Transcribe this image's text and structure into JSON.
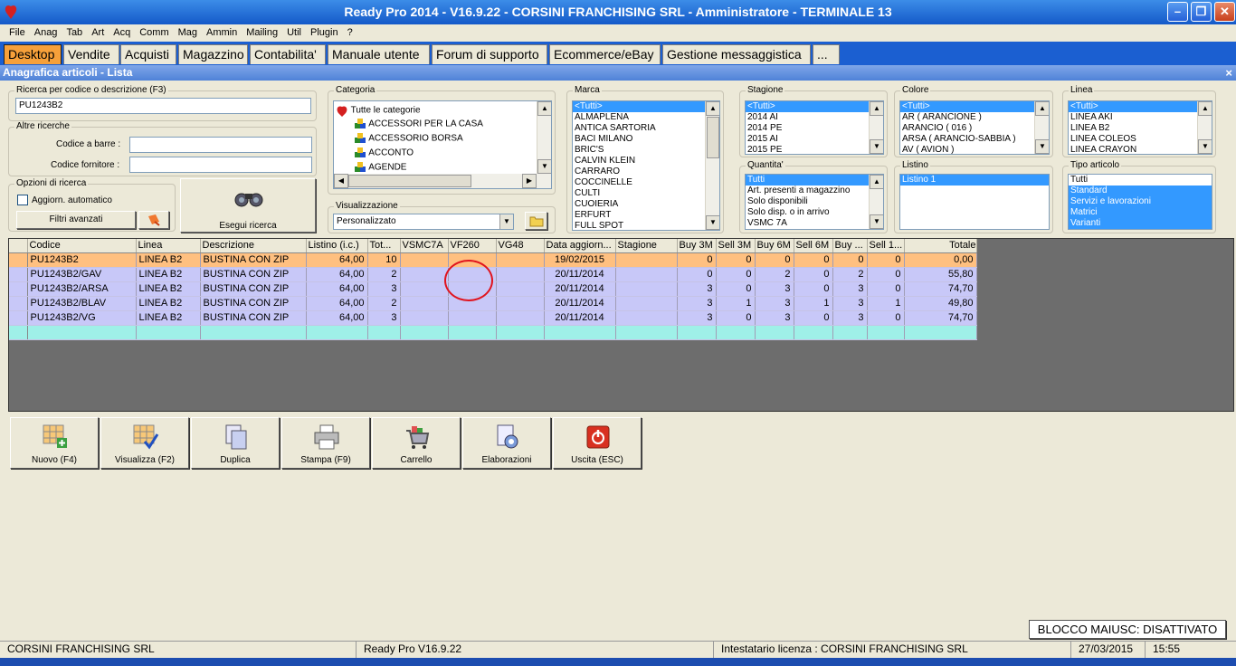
{
  "window": {
    "title": "Ready Pro 2014 - V16.9.22 - CORSINI FRANCHISING SRL - Amministratore - TERMINALE 13"
  },
  "menu": [
    "File",
    "Anag",
    "Tab",
    "Art",
    "Acq",
    "Comm",
    "Mag",
    "Ammin",
    "Mailing",
    "Util",
    "Plugin",
    "?"
  ],
  "tabs": [
    "Desktop",
    "Vendite",
    "Acquisti",
    "Magazzino",
    "Contabilita'",
    "Manuale utente",
    "Forum di supporto",
    "Ecommerce/eBay",
    "Gestione messaggistica",
    "..."
  ],
  "panel": {
    "title": "Anagrafica articoli  - Lista",
    "close": "×"
  },
  "search": {
    "label": "Ricerca per codice o descrizione (F3)",
    "value": "PU1243B2",
    "altre": "Altre ricerche",
    "barcode_label": "Codice a barre :",
    "barcode_value": "",
    "supplier_label": "Codice fornitore :",
    "supplier_value": "",
    "options_label": "Opzioni di ricerca",
    "auto_update": "Aggiorn. automatico",
    "advanced": "Filtri avanzati",
    "run": "Esegui ricerca"
  },
  "categoria": {
    "label": "Categoria",
    "root": "Tutte le categorie",
    "items": [
      "ACCESSORI PER LA CASA",
      "ACCESSORIO BORSA",
      "ACCONTO",
      "AGENDE"
    ]
  },
  "visualizzazione": {
    "label": "Visualizzazione",
    "value": "Personalizzato"
  },
  "marca": {
    "label": "Marca",
    "items": [
      "<Tutti>",
      "ALMAPLENA",
      "ANTICA SARTORIA",
      "BACI MILANO",
      "BRIC'S",
      "CALVIN KLEIN",
      "CARRARO",
      "COCCINELLE",
      "CULTI",
      "CUOIERIA",
      "ERFURT",
      "FULL SPOT"
    ]
  },
  "stagione": {
    "label": "Stagione",
    "items": [
      "<Tutti>",
      "2014 AI",
      "2014 PE",
      "2015 AI",
      "2015 PE"
    ]
  },
  "colore": {
    "label": "Colore",
    "items": [
      "<Tutti>",
      "AR ( ARANCIONE )",
      "ARANCIO ( 016 )",
      "ARSA ( ARANCIO-SABBIA )",
      "AV ( AVION )"
    ]
  },
  "linea": {
    "label": "Linea",
    "items": [
      "<Tutti>",
      "LINEA AKI",
      "LINEA B2",
      "LINEA COLEOS",
      "LINEA CRAYON"
    ]
  },
  "quantita": {
    "label": "Quantita'",
    "items": [
      "Tutti",
      "Art. presenti a magazzino",
      "Solo disponibili",
      "Solo disp. o in arrivo",
      "VSMC 7A"
    ]
  },
  "listino": {
    "label": "Listino",
    "items": [
      "Listino 1"
    ]
  },
  "tipo": {
    "label": "Tipo articolo",
    "items": [
      "Tutti",
      "Standard",
      "Servizi e lavorazioni",
      "Matrici",
      "Varianti"
    ]
  },
  "table": {
    "columns": [
      "Codice",
      "Linea",
      "Descrizione",
      "Listino (i.c.)",
      "Tot...",
      "VSMC7A",
      "VF260",
      "VG48",
      "Data aggiorn...",
      "Stagione",
      "Buy 3M",
      "Sell 3M",
      "Buy 6M",
      "Sell 6M",
      "Buy ...",
      "Sell 1...",
      "Totale"
    ],
    "rows": [
      [
        "PU1243B2",
        "LINEA B2",
        "BUSTINA CON ZIP",
        "64,00",
        "10",
        "",
        "",
        "",
        "19/02/2015",
        "",
        "0",
        "0",
        "0",
        "0",
        "0",
        "0",
        "0,00"
      ],
      [
        "PU1243B2/GAV",
        "LINEA B2",
        "BUSTINA CON ZIP",
        "64,00",
        "2",
        "",
        "",
        "",
        "20/11/2014",
        "",
        "0",
        "0",
        "2",
        "0",
        "2",
        "0",
        "55,80"
      ],
      [
        "PU1243B2/ARSA",
        "LINEA B2",
        "BUSTINA CON ZIP",
        "64,00",
        "3",
        "",
        "",
        "",
        "20/11/2014",
        "",
        "3",
        "0",
        "3",
        "0",
        "3",
        "0",
        "74,70"
      ],
      [
        "PU1243B2/BLAV",
        "LINEA B2",
        "BUSTINA CON ZIP",
        "64,00",
        "2",
        "",
        "",
        "",
        "20/11/2014",
        "",
        "3",
        "1",
        "3",
        "1",
        "3",
        "1",
        "49,80"
      ],
      [
        "PU1243B2/VG",
        "LINEA B2",
        "BUSTINA CON ZIP",
        "64,00",
        "3",
        "",
        "",
        "",
        "20/11/2014",
        "",
        "3",
        "0",
        "3",
        "0",
        "3",
        "0",
        "74,70"
      ]
    ]
  },
  "toolbar": [
    "Nuovo (F4)",
    "Visualizza (F2)",
    "Duplica",
    "Stampa (F9)",
    "Carrello",
    "Elaborazioni",
    "Uscita (ESC)"
  ],
  "status": {
    "company": "CORSINI FRANCHISING SRL",
    "version": "Ready Pro V16.9.22",
    "license": "Intestatario licenza : CORSINI FRANCHISING SRL",
    "date": "27/03/2015",
    "time": "15:55",
    "caps": "BLOCCO MAIUSC: DISATTIVATO"
  }
}
